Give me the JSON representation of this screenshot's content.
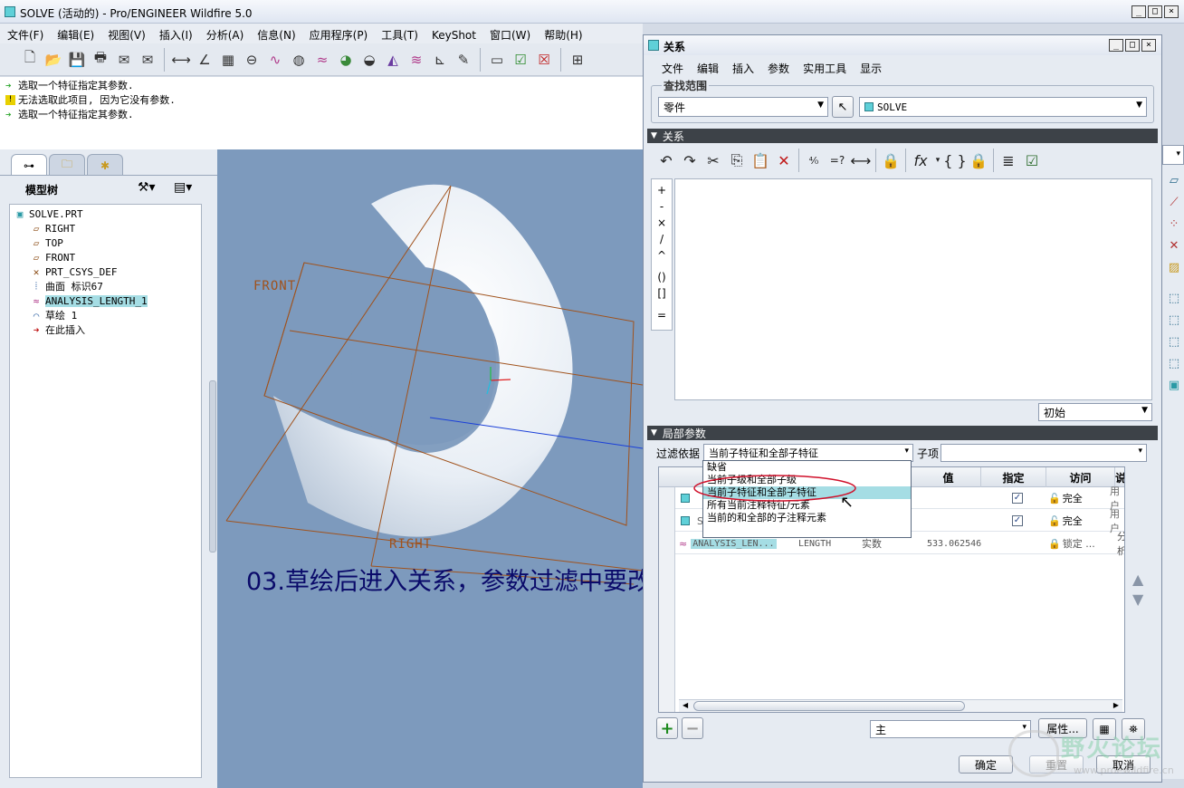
{
  "main_window": {
    "title": "SOLVE (活动的) - Pro/ENGINEER Wildfire 5.0",
    "menu": [
      "文件(F)",
      "编辑(E)",
      "视图(V)",
      "插入(I)",
      "分析(A)",
      "信息(N)",
      "应用程序(P)",
      "工具(T)",
      "KeyShot",
      "窗口(W)",
      "帮助(H)"
    ],
    "messages": [
      {
        "icon": "arrow",
        "text": "选取一个特征指定其参数."
      },
      {
        "icon": "warning",
        "text": "无法选取此项目, 因为它没有参数."
      },
      {
        "icon": "arrow",
        "text": "选取一个特征指定其参数."
      }
    ]
  },
  "model_tree": {
    "title": "模型树",
    "items": [
      {
        "label": "SOLVE.PRT",
        "icon": "part-icon",
        "level": 0
      },
      {
        "label": "RIGHT",
        "icon": "datum-plane-icon",
        "level": 1
      },
      {
        "label": "TOP",
        "icon": "datum-plane-icon",
        "level": 1
      },
      {
        "label": "FRONT",
        "icon": "datum-plane-icon",
        "level": 1
      },
      {
        "label": "PRT_CSYS_DEF",
        "icon": "csys-icon",
        "level": 1
      },
      {
        "label": "曲面 标识67",
        "icon": "surface-icon",
        "level": 1
      },
      {
        "label": "ANALYSIS_LENGTH_1",
        "icon": "analysis-icon",
        "level": 1,
        "selected": true
      },
      {
        "label": "草绘 1",
        "icon": "sketch-icon",
        "level": 1
      },
      {
        "label": "在此插入",
        "icon": "insert-here-icon",
        "level": 1
      }
    ]
  },
  "canvas": {
    "datum_labels": [
      "FRONT",
      "RIGHT"
    ],
    "caption": "03.草绘后进入关系，参数过滤中要改为红圈中的"
  },
  "relations_dialog": {
    "title": "关系",
    "menu": [
      "文件",
      "编辑",
      "插入",
      "参数",
      "实用工具",
      "显示"
    ],
    "lookup": {
      "label": "查找范围",
      "type_value": "零件",
      "model_value": "SOLVE"
    },
    "relations_section": {
      "label": "关系",
      "editor_text": "",
      "operators": [
        "+",
        "-",
        "×",
        "/",
        "^",
        "()",
        "[]",
        "="
      ],
      "initial_value": "初始"
    },
    "local_params": {
      "label": "局部参数",
      "filter_label": "过滤依据",
      "filter_value": "当前子特征和全部子特征",
      "sub_label": "子项",
      "sub_value": "",
      "columns": [
        "所有",
        "值",
        "指定",
        "访问"
      ],
      "rows": [
        {
          "name": "",
          "type": "",
          "value": "",
          "designated": true,
          "access": "完全",
          "source": "用户"
        },
        {
          "name": "S",
          "type": "",
          "value": "",
          "designated": true,
          "access": "完全",
          "source": "用户"
        },
        {
          "name": "ANALYSIS_LEN...",
          "type": "LENGTH",
          "kind": "实数",
          "value": "533.062546",
          "designated": false,
          "access": "锁定 ...",
          "source": "分析"
        }
      ],
      "dropdown_options": [
        {
          "label": "缺省",
          "selected": false
        },
        {
          "label": "当前子级和全部子级",
          "selected": false
        },
        {
          "label": "当前子特征和全部子特征",
          "selected": true
        },
        {
          "label": "所有当前注释特征/元素",
          "selected": false
        },
        {
          "label": "当前的和全部的子注释元素",
          "selected": false
        }
      ],
      "bottom_combo": "主",
      "properties_button": "属性..."
    },
    "buttons": {
      "ok": "确定",
      "reset": "重置",
      "cancel": "取消"
    }
  },
  "watermark": {
    "text": "野火论坛",
    "url": "www.proewildfire.cn"
  },
  "colors": {
    "accent_highlight": "#a5dde4",
    "red_circle": "#d0102a",
    "caption": "#0a0a6a",
    "canvas_bg": "#7d9abd"
  }
}
